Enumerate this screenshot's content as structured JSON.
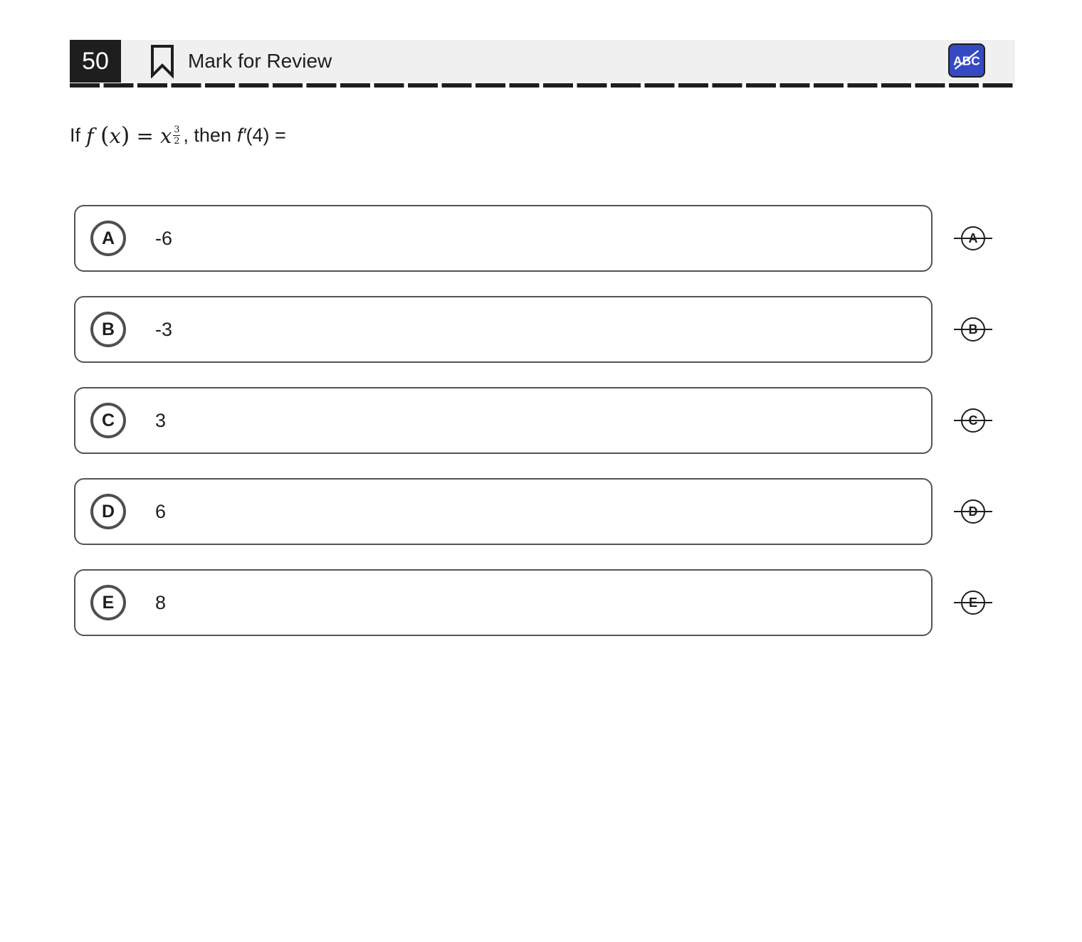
{
  "header": {
    "question_number": "50",
    "mark_for_review_label": "Mark for Review",
    "eliminator_label": "ABC",
    "colors": {
      "number_bg": "#1e1e1e",
      "bar_bg": "#f0f0f0",
      "eliminator_bg": "#3549c2"
    }
  },
  "question": {
    "prefix": "If",
    "func": "f",
    "var": "x",
    "equals": "=",
    "base": "x",
    "exp_num": "3",
    "exp_den": "2",
    "mid": ", then",
    "deriv_f": "f′",
    "deriv_arg": "(4) ="
  },
  "choices": [
    {
      "letter": "A",
      "text": "-6"
    },
    {
      "letter": "B",
      "text": "-3"
    },
    {
      "letter": "C",
      "text": "3"
    },
    {
      "letter": "D",
      "text": "6"
    },
    {
      "letter": "E",
      "text": "8"
    }
  ],
  "icons": {
    "bookmark": "bookmark-icon",
    "eliminator": "abc-strikethrough-icon",
    "strike": "strikethrough-letter-icon"
  }
}
